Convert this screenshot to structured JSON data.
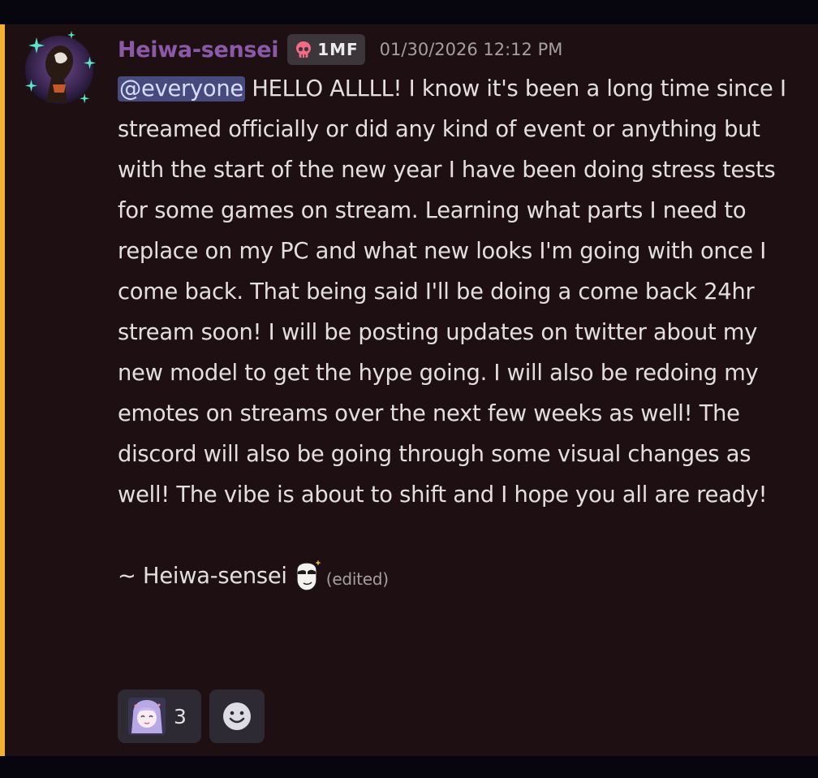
{
  "message": {
    "author": "Heiwa-sensei",
    "role_tag": {
      "icon": "skull-icon",
      "text": "1MF",
      "icon_color": "#f26a84"
    },
    "timestamp": "01/30/2026 12:12 PM",
    "mention": "@everyone",
    "paragraphs": [
      " HELLO ALLLL! I know it's been a long time since I streamed officially or did any kind of event or anything but with the start of the new year I have been doing stress tests for some games on stream. Learning what parts I need to replace on my PC and what new looks I'm going with once I come back. That being said I'll be doing a come back 24hr stream soon! I will be posting updates on twitter about my new model to get the hype going. I will also be redoing my emotes on streams over the next few weeks as well! The discord will also be going through some visual changes as well! The vibe is about to shift and I hope you all are ready!"
    ],
    "signature": "~ Heiwa-sensei",
    "signature_emoji": "smug-sparkle-emoji",
    "edited_label": "(edited)",
    "colors": {
      "mention_bar": "#f1b232",
      "username": "#8a5aa8",
      "mention_bg": "#464a7c",
      "background": "#1e1012"
    }
  },
  "reactions": [
    {
      "emoji": "anime-girl-emoji",
      "count": "3"
    },
    {
      "emoji": "add-reaction-icon"
    }
  ]
}
